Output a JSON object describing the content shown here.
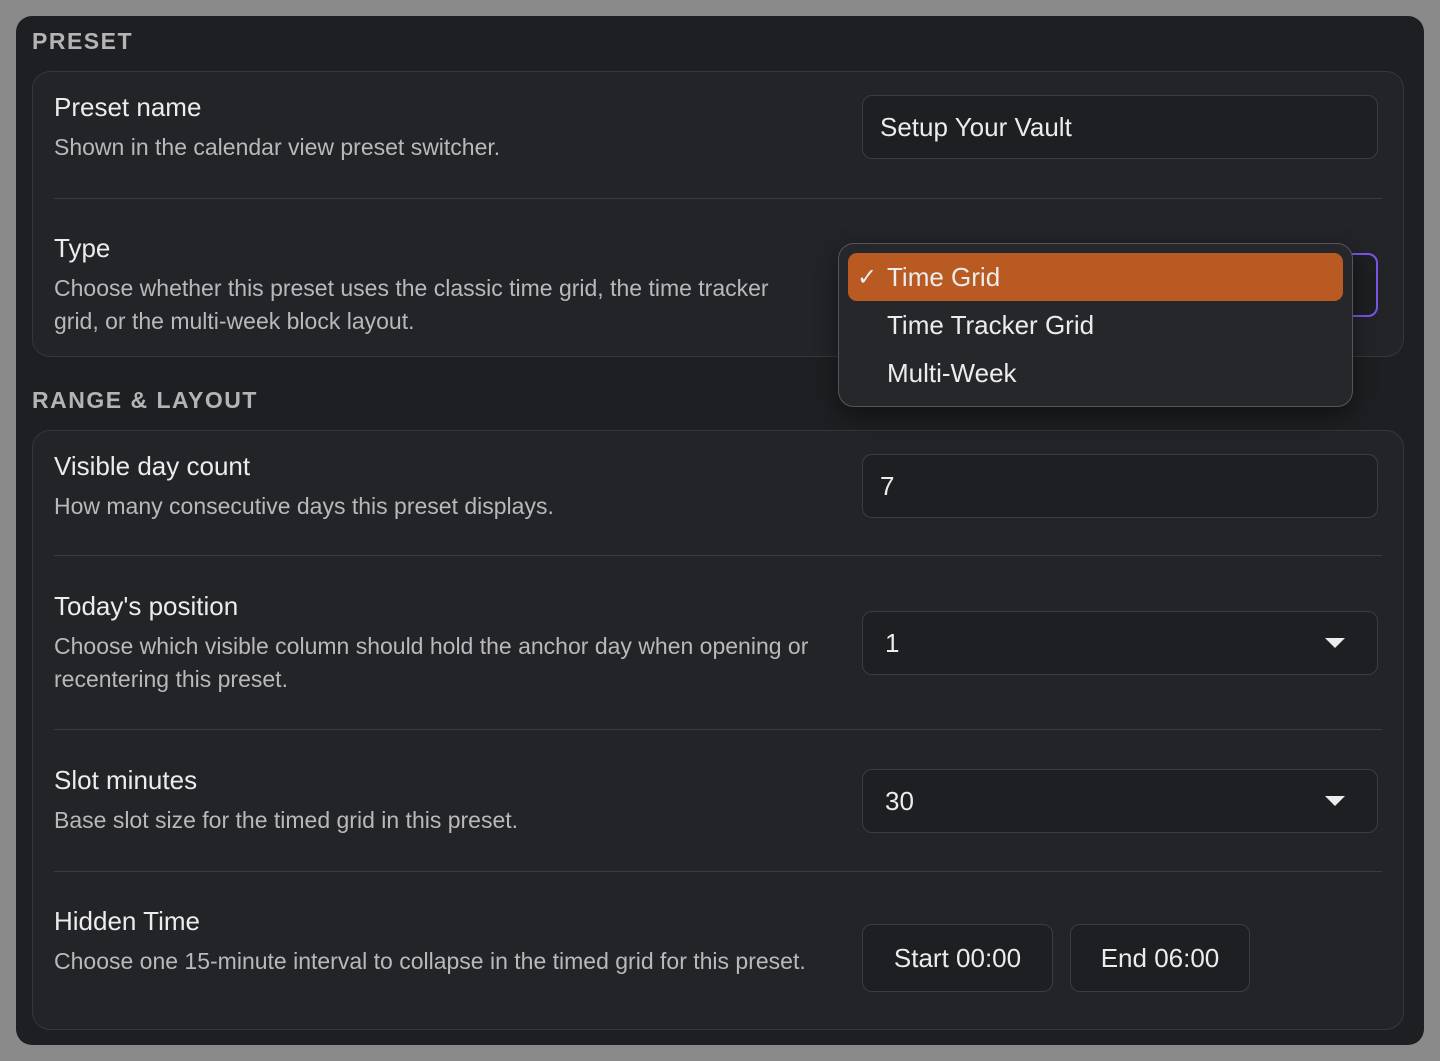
{
  "sections": {
    "preset_heading": "PRESET",
    "range_heading": "RANGE & LAYOUT"
  },
  "preset_name": {
    "label": "Preset name",
    "description": "Shown in the calendar view preset switcher.",
    "value": "Setup Your Vault"
  },
  "type": {
    "label": "Type",
    "description": "Choose whether this preset uses the classic time grid, the time tracker grid, or the multi-week block layout.",
    "options": [
      {
        "label": "Time Grid",
        "selected": true
      },
      {
        "label": "Time Tracker Grid",
        "selected": false
      },
      {
        "label": "Multi-Week",
        "selected": false
      }
    ],
    "check_mark": "✓"
  },
  "visible_day_count": {
    "label": "Visible day count",
    "description": "How many consecutive days this preset displays.",
    "value": "7"
  },
  "todays_position": {
    "label": "Today's position",
    "description": "Choose which visible column should hold the anchor day when opening or recentering this preset.",
    "value": "1"
  },
  "slot_minutes": {
    "label": "Slot minutes",
    "description": "Base slot size for the timed grid in this preset.",
    "value": "30"
  },
  "hidden_time": {
    "label": "Hidden Time",
    "description": "Choose one 15-minute interval to collapse in the timed grid for this preset.",
    "start_label": "Start 00:00",
    "end_label": "End 06:00"
  },
  "colors": {
    "panel_bg": "#1e1f22",
    "selected_option": "#b95a22",
    "focus_ring": "#7b55e8"
  }
}
